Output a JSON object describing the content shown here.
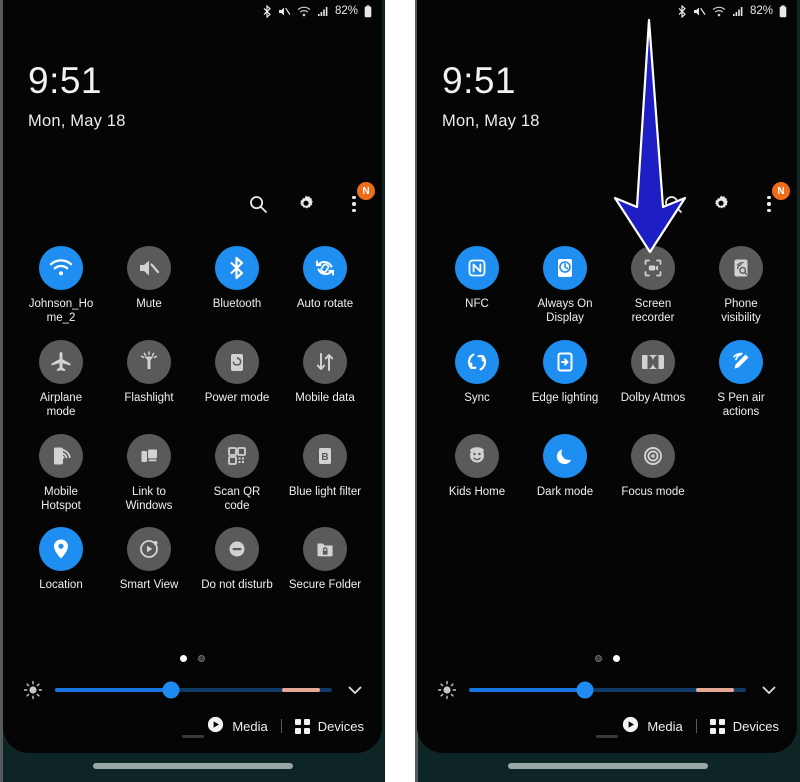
{
  "meta": {
    "device": "android-quick-settings",
    "accent_blue": "#1e8ef0",
    "tile_off_gray": "#5a5a5a",
    "badge_orange": "#ef6c1a",
    "arrow_color": "#1d1ec4"
  },
  "statusbar": {
    "battery_text": "82%",
    "icons": [
      "bluetooth-icon",
      "mute-icon",
      "wifi-icon",
      "signal-icon",
      "battery-icon"
    ]
  },
  "header": {
    "time": "9:51",
    "date": "Mon, May 18",
    "actions": {
      "search": "search-icon",
      "settings": "gear-icon",
      "more": "more-vertical-icon",
      "badge_text": "N"
    }
  },
  "panels": [
    {
      "id": "page-1",
      "page_dots": {
        "count": 2,
        "active_index": 0
      },
      "tiles": [
        {
          "label": "Johnson_Home_2",
          "icon": "wifi-icon",
          "state": "on"
        },
        {
          "label": "Mute",
          "icon": "mute-icon",
          "state": "off"
        },
        {
          "label": "Bluetooth",
          "icon": "bluetooth-icon",
          "state": "on"
        },
        {
          "label": "Auto rotate",
          "icon": "auto-rotate-icon",
          "state": "on"
        },
        {
          "label": "Airplane mode",
          "icon": "airplane-icon",
          "state": "off"
        },
        {
          "label": "Flashlight",
          "icon": "flashlight-icon",
          "state": "off"
        },
        {
          "label": "Power mode",
          "icon": "power-mode-icon",
          "state": "off"
        },
        {
          "label": "Mobile data",
          "icon": "mobile-data-icon",
          "state": "off"
        },
        {
          "label": "Mobile Hotspot",
          "icon": "hotspot-icon",
          "state": "off"
        },
        {
          "label": "Link to Windows",
          "icon": "link-to-windows-icon",
          "state": "off"
        },
        {
          "label": "Scan QR code",
          "icon": "qr-code-icon",
          "state": "off"
        },
        {
          "label": "Blue light filter",
          "icon": "blue-light-filter-icon",
          "state": "off"
        },
        {
          "label": "Location",
          "icon": "location-pin-icon",
          "state": "on"
        },
        {
          "label": "Smart View",
          "icon": "smart-view-icon",
          "state": "off"
        },
        {
          "label": "Do not disturb",
          "icon": "do-not-disturb-icon",
          "state": "off"
        },
        {
          "label": "Secure Folder",
          "icon": "secure-folder-icon",
          "state": "off"
        }
      ]
    },
    {
      "id": "page-2",
      "page_dots": {
        "count": 2,
        "active_index": 1
      },
      "tiles": [
        {
          "label": "NFC",
          "icon": "nfc-icon",
          "state": "on"
        },
        {
          "label": "Always On Display",
          "icon": "always-on-display-icon",
          "state": "on"
        },
        {
          "label": "Screen recorder",
          "icon": "screen-recorder-icon",
          "state": "off"
        },
        {
          "label": "Phone visibility",
          "icon": "phone-visibility-icon",
          "state": "off"
        },
        {
          "label": "Sync",
          "icon": "sync-icon",
          "state": "on"
        },
        {
          "label": "Edge lighting",
          "icon": "edge-lighting-icon",
          "state": "on"
        },
        {
          "label": "Dolby Atmos",
          "icon": "dolby-atmos-icon",
          "state": "off"
        },
        {
          "label": "S Pen air actions",
          "icon": "s-pen-air-actions-icon",
          "state": "on"
        },
        {
          "label": "Kids Home",
          "icon": "kids-home-icon",
          "state": "off"
        },
        {
          "label": "Dark mode",
          "icon": "dark-mode-icon",
          "state": "on"
        },
        {
          "label": "Focus mode",
          "icon": "focus-mode-icon",
          "state": "off"
        }
      ]
    }
  ],
  "brightness": {
    "icon": "brightness-icon",
    "value_percent": 42,
    "expand_icon": "chevron-down-icon"
  },
  "footer": {
    "media_label": "Media",
    "media_icon": "play-circle-icon",
    "devices_label": "Devices",
    "devices_icon": "grid-icon"
  },
  "annotation": {
    "arrow": "down-arrow-pointer",
    "points_to": "Screen recorder"
  }
}
